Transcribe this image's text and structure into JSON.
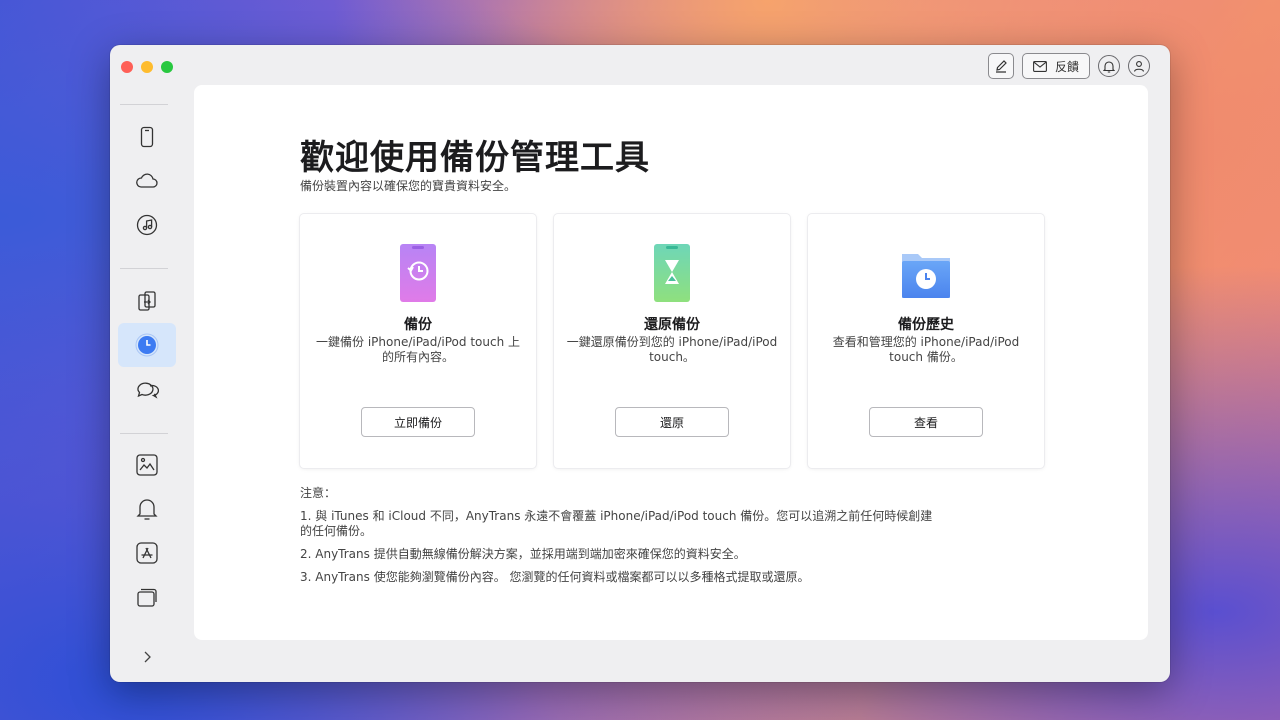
{
  "window": {
    "title": ""
  },
  "toolbar": {
    "feedback_label": "反饋"
  },
  "sidebar": {
    "items": [
      {
        "icon": "phone-icon"
      },
      {
        "icon": "cloud-icon"
      },
      {
        "icon": "music-icon"
      },
      {
        "icon": "transfer-icon"
      },
      {
        "icon": "backup-clock-icon",
        "active": true
      },
      {
        "icon": "chat-icon"
      },
      {
        "icon": "photo-transfer-icon"
      },
      {
        "icon": "bell-icon"
      },
      {
        "icon": "app-store-icon"
      },
      {
        "icon": "cards-icon"
      }
    ],
    "expand_icon": "chevron-right-icon"
  },
  "main": {
    "title": "歡迎使用備份管理工具",
    "subtitle": "備份裝置內容以確保您的寶貴資料安全。",
    "cards": [
      {
        "title": "備份",
        "desc": "一鍵備份 iPhone/iPad/iPod touch 上的所有內容。",
        "button": "立即備份"
      },
      {
        "title": "還原備份",
        "desc": "一鍵還原備份到您的 iPhone/iPad/iPod touch。",
        "button": "還原"
      },
      {
        "title": "備份歷史",
        "desc": "查看和管理您的 iPhone/iPad/iPod touch 備份。",
        "button": "查看"
      }
    ],
    "notes": {
      "heading": "注意：",
      "items": [
        "1. 與 iTunes 和 iCloud 不同，AnyTrans 永遠不會覆蓋 iPhone/iPad/iPod touch 備份。您可以追溯之前任何時候創建的任何備份。",
        "2. AnyTrans 提供自動無線備份解決方案，並採用端到端加密來確保您的資料安全。",
        "3. AnyTrans 使您能夠瀏覽備份內容。 您瀏覽的任何資料或檔案都可以以多種格式提取或還原。"
      ]
    }
  },
  "colors": {
    "accent": "#3d7bf2",
    "active_bg": "#d6e6fb"
  }
}
